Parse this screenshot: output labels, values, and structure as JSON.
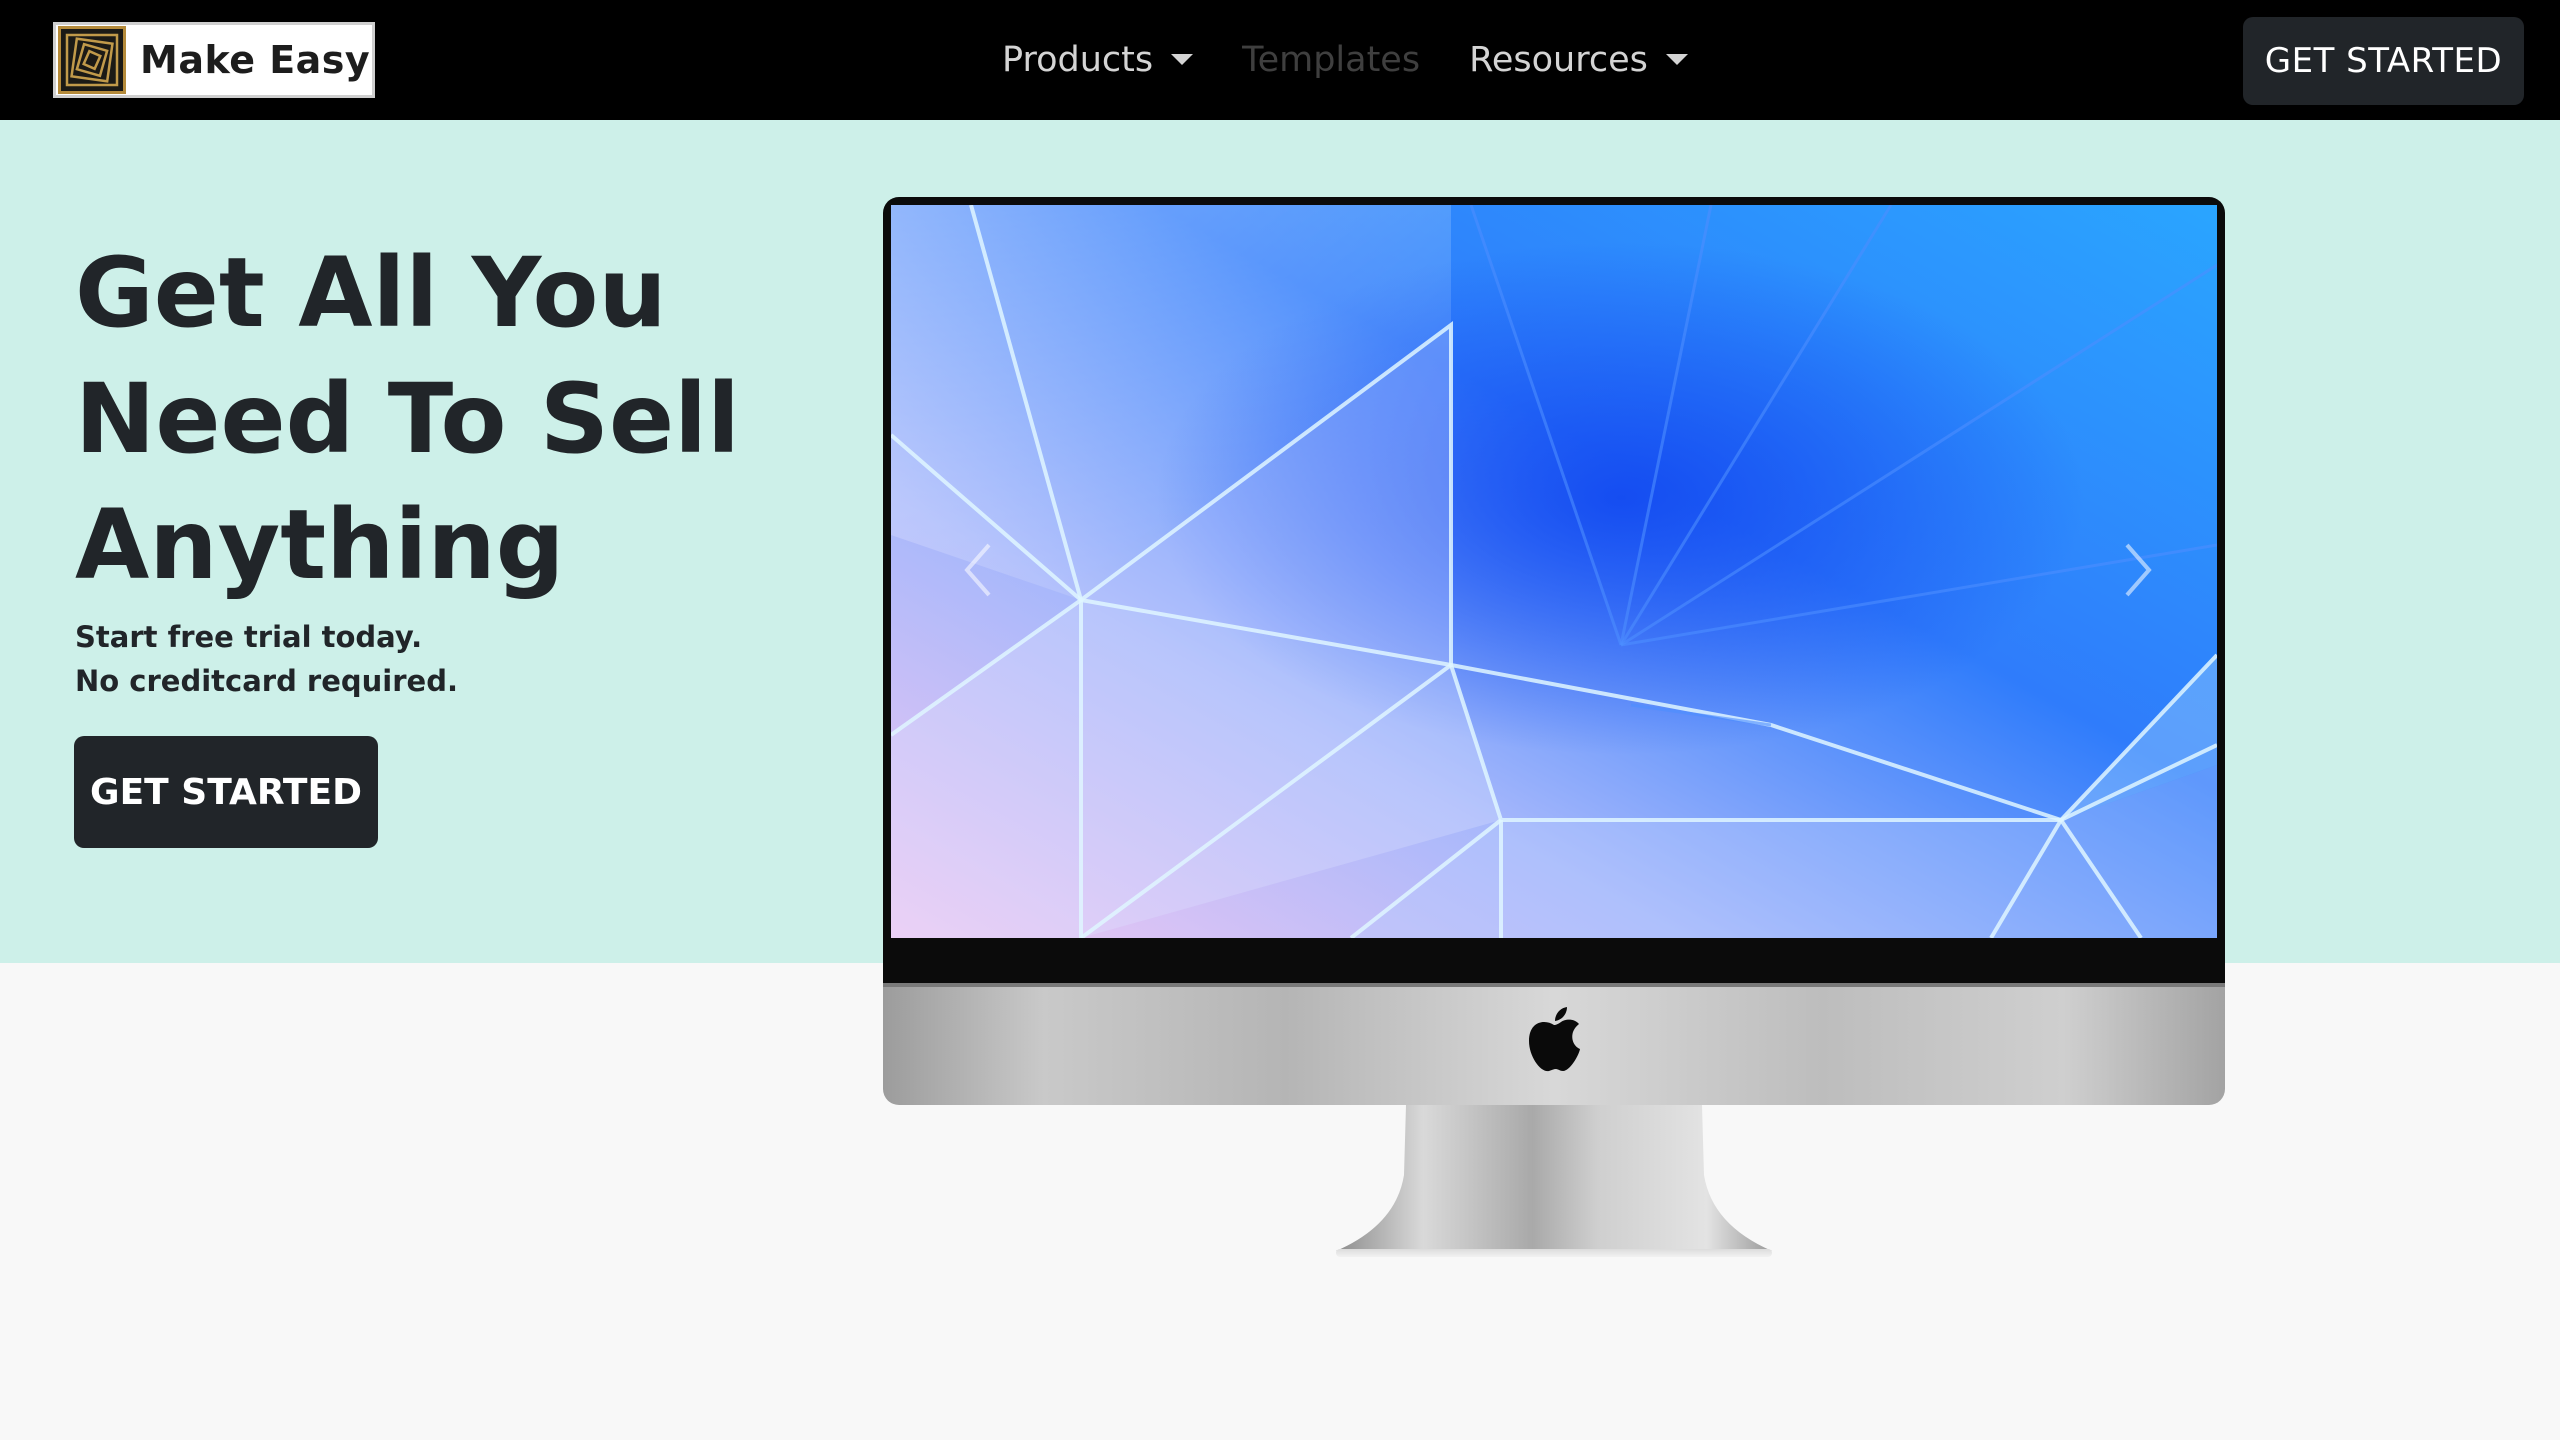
{
  "navbar": {
    "brand": {
      "name": "Make Easy",
      "logo_icon": "spiral-logo-icon"
    },
    "links": [
      {
        "label": "Products",
        "has_dropdown": true,
        "state": "active"
      },
      {
        "label": "Templates",
        "has_dropdown": false,
        "state": "disabled"
      },
      {
        "label": "Resources",
        "has_dropdown": true,
        "state": "active"
      }
    ],
    "cta_label": "GET STARTED"
  },
  "hero": {
    "title": "Get All You Need To Sell Anything",
    "subtitle_line1": "Start free trial today.",
    "subtitle_line2": "No creditcard required.",
    "cta_label": "GET STARTED"
  },
  "showcase": {
    "device": "desktop-monitor",
    "carousel": {
      "prev_icon": "chevron-left-icon",
      "next_icon": "chevron-right-icon"
    },
    "badge_icon": "apple-logo-icon"
  },
  "colors": {
    "navbar_bg": "#000000",
    "hero_bg": "#cdf0e9",
    "page_bg": "#f8f8f8",
    "button_bg": "#212529",
    "button_text": "#ffffff",
    "heading_text": "#212529"
  }
}
